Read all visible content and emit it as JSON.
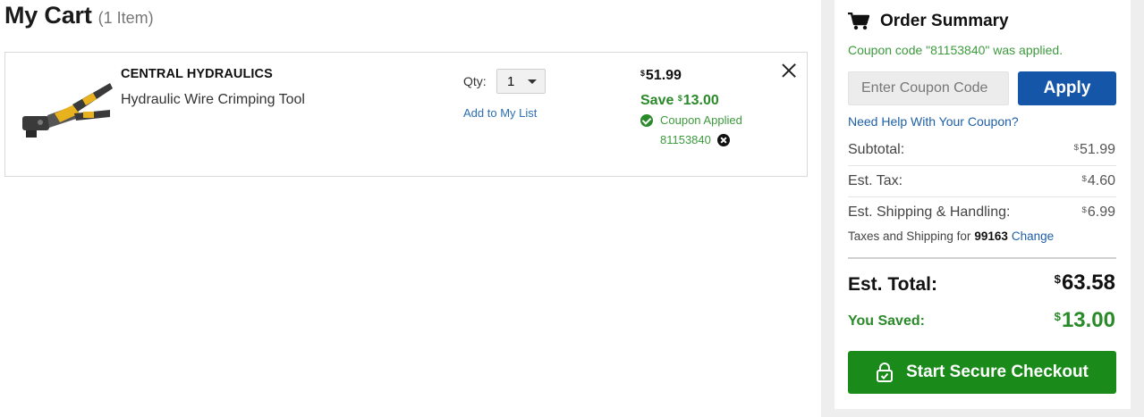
{
  "cart": {
    "title": "My Cart",
    "item_count": "(1 Item)"
  },
  "item": {
    "brand": "CENTRAL HYDRAULICS",
    "name": "Hydraulic Wire Crimping Tool",
    "qty_label": "Qty:",
    "qty_value": "1",
    "add_to_list": "Add to My List",
    "price_symbol": "$",
    "price": "51.99",
    "save_prefix": "Save ",
    "save_symbol": "$",
    "save_amount": "13.00",
    "coupon_applied": "Coupon Applied",
    "coupon_code": "81153840",
    "product_image_icon": "crimping-tool-image"
  },
  "summary": {
    "title": "Order Summary",
    "coupon_message": "Coupon code \"81153840\" was applied.",
    "coupon_placeholder": "Enter Coupon Code",
    "apply_label": "Apply",
    "help_link": "Need Help With Your Coupon?",
    "subtotal_label": "Subtotal:",
    "subtotal_value": "51.99",
    "tax_label": "Est. Tax:",
    "tax_value": "4.60",
    "shipping_label": "Est. Shipping & Handling:",
    "shipping_value": "6.99",
    "taxes_shipping_text": "Taxes and Shipping for",
    "zip": "99163",
    "change_label": "Change",
    "total_label": "Est. Total:",
    "total_value": "63.58",
    "saved_label": "You Saved:",
    "saved_value": "13.00",
    "currency_symbol": "$",
    "checkout_label": "Start Secure Checkout"
  },
  "colors": {
    "brand_blue": "#1556a8",
    "link_blue": "#1e5fa8",
    "success_green": "#2a8a2a",
    "checkout_green": "#1a8a1a"
  },
  "icons": {
    "cart": "shopping-cart-icon",
    "remove_item": "close-icon",
    "coupon_check": "check-circle-icon",
    "coupon_remove": "close-circle-icon",
    "checkout_lock": "lock-icon",
    "qty_dropdown": "chevron-down-icon"
  }
}
